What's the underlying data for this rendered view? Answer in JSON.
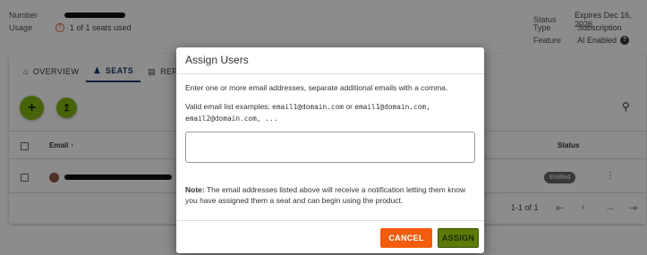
{
  "header": {
    "number_label": "Number",
    "usage_label": "Usage",
    "usage_value": "1 of 1 seats used",
    "status_label": "Status",
    "status_value": "Expires Dec 16, 2026",
    "type_label": "Type",
    "type_value": "Subscription",
    "feature_label": "Feature",
    "feature_value": "AI Enabled"
  },
  "tabs": [
    {
      "label": "OVERVIEW",
      "icon": "home-icon"
    },
    {
      "label": "SEATS",
      "icon": "users-icon"
    },
    {
      "label": "REP",
      "icon": "report-icon"
    }
  ],
  "table": {
    "columns": [
      "Email",
      "Status"
    ],
    "row_status": "Entitled",
    "pagination": "1-1 of 1"
  },
  "dialog": {
    "title": "Assign Users",
    "instruction": "Enter one or more email addresses, separate additional emails with a comma.",
    "examples_prefix": "Valid email list examples: ",
    "example_1": "email1@domain.com",
    "examples_or": " or ",
    "example_2": "email1@domain.com,",
    "example_3": "email2@domain.com, ...",
    "input_value": "",
    "note_label": "Note:",
    "note_text": " The email addresses listed above will receive a notification letting them know you have assigned them a seat and can begin using the product.",
    "cancel_label": "CANCEL",
    "assign_label": "ASSIGN"
  },
  "colors": {
    "accent_green": "#84b713",
    "cancel_orange": "#f25c0f",
    "assign_green": "#5c7a07"
  }
}
